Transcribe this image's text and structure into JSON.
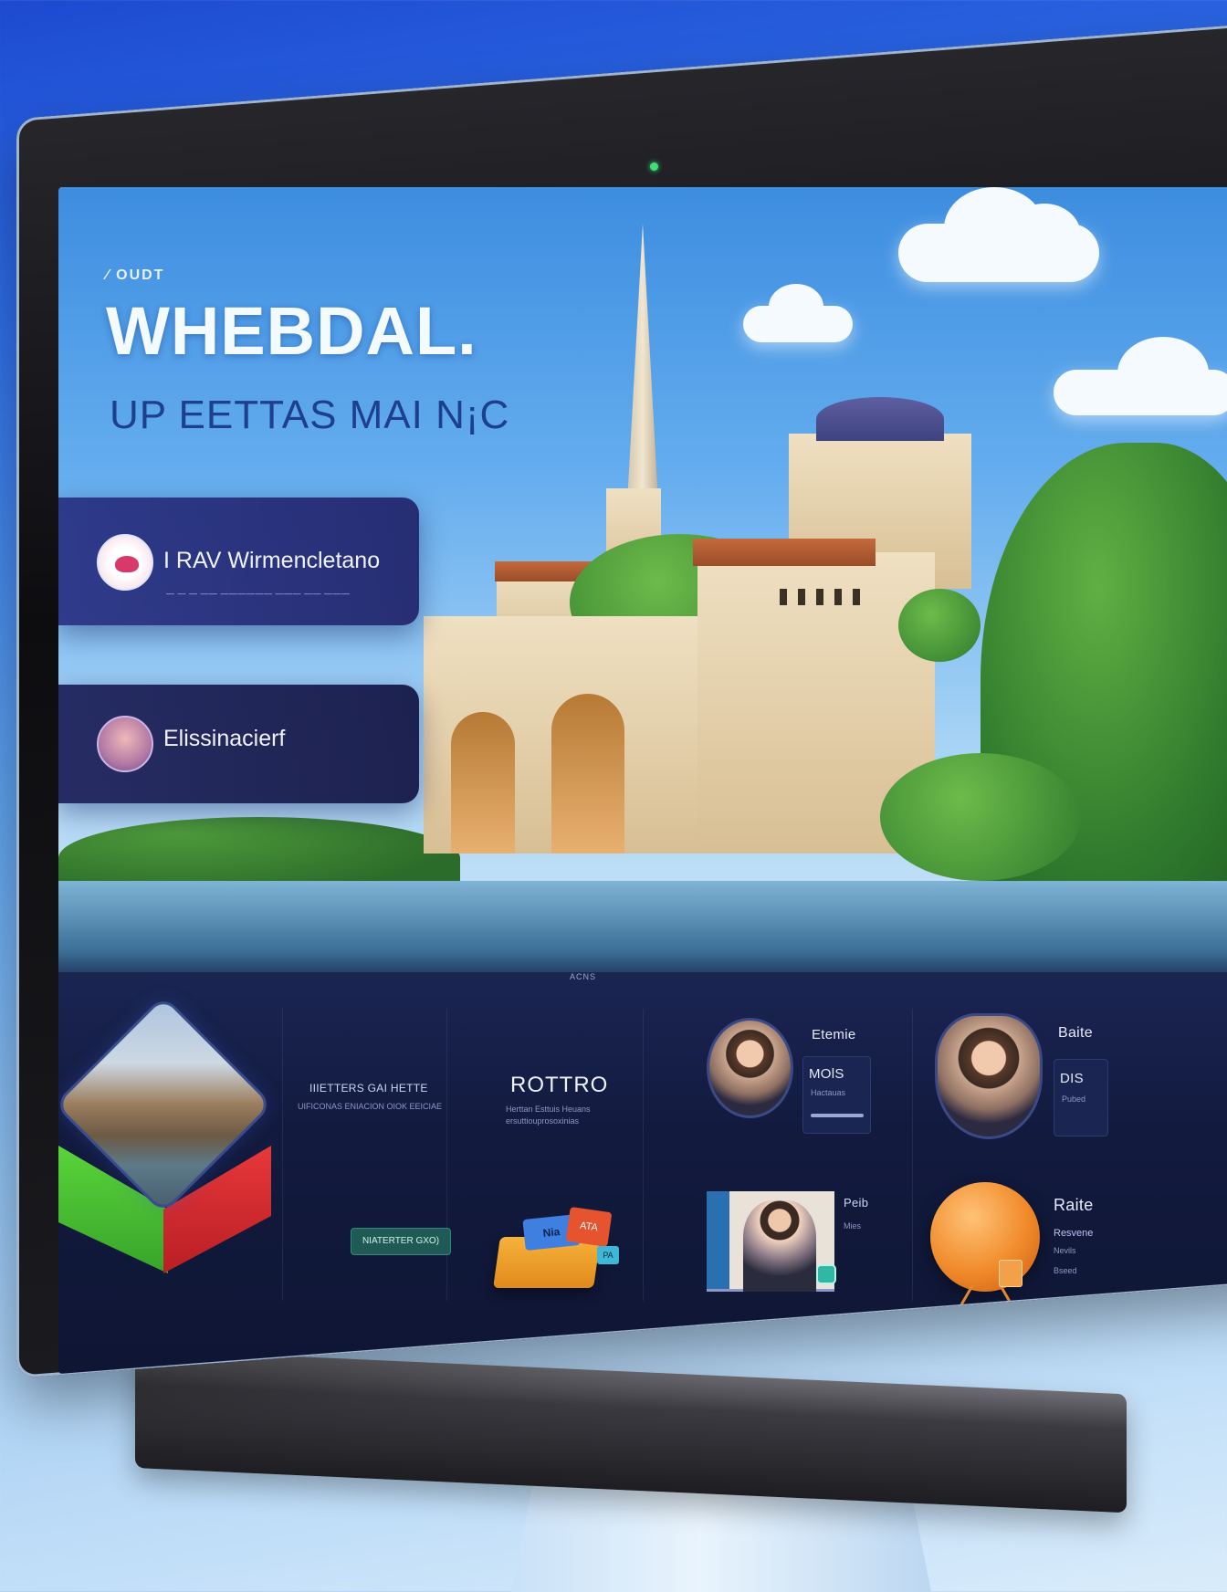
{
  "hero": {
    "eyebrow": "⁄ OUDT",
    "title": "WHEBDAL.",
    "subtitle": "UP EETTAS MAI N¡C"
  },
  "cards": [
    {
      "name": "I RAV Wirmencletano",
      "meta": "— — — —— —————— ——— —— ———"
    },
    {
      "name": "Elissinacierf"
    }
  ],
  "dashboard": {
    "caption": "ACNS",
    "col2": {
      "heading": "IIIETTERS GAI HETTE",
      "subheading": "UIFICONAS ENIACION OIOK EEICIAE",
      "button_label": "NIATERTER GXO)"
    },
    "col3": {
      "heading": "ROTTRO",
      "line1": "Herttan Esttuis Heuans",
      "line2": "ersuttiouprosoxinias",
      "boxes": {
        "blue": "Nia",
        "red": "ATA",
        "teal": "PA"
      }
    },
    "col4": {
      "name": "Etemie",
      "mid_label": "MOlS",
      "mid_small": "Hactauas",
      "lower_label": "Peib",
      "lower_small": "Mies"
    },
    "col5": {
      "name": "Baite",
      "mid_label": "DIS",
      "mid_small": "Pubed",
      "lower_title": "Raite",
      "lower_line1": "Resvene",
      "lower_line2": "Nevils",
      "lower_line3": "Bseed"
    }
  },
  "colors": {
    "accent_green": "#37a42a",
    "accent_red": "#b81f24",
    "card_navy": "#23286e",
    "dash_navy": "#121a3e"
  },
  "icons": [
    "camera-indicator-icon",
    "avatar-icon",
    "cube-logo-icon",
    "boxes-icon",
    "play-icon",
    "globe-icon"
  ]
}
